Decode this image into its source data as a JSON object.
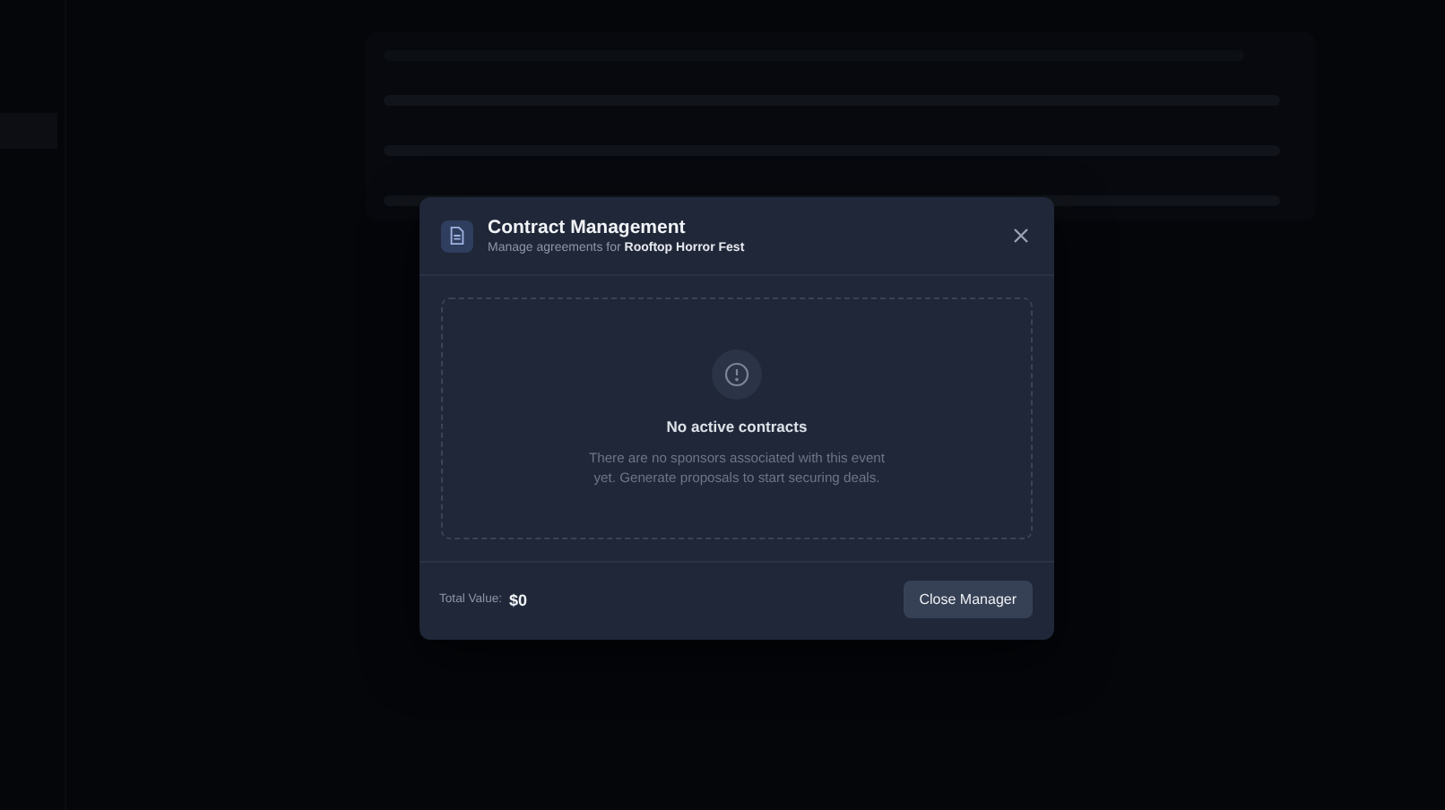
{
  "dialog": {
    "title": "Contract Management",
    "subtitle": "Manage agreements for **Rooftop Horror Fest**",
    "empty_state": {
      "title": "No active contracts",
      "message": "There are no sponsors associated with this event yet. Generate proposals to start securing deals."
    },
    "total_label": "Total Value:",
    "total_value": "$0",
    "buttons": [
      "Close Manager"
    ]
  }
}
